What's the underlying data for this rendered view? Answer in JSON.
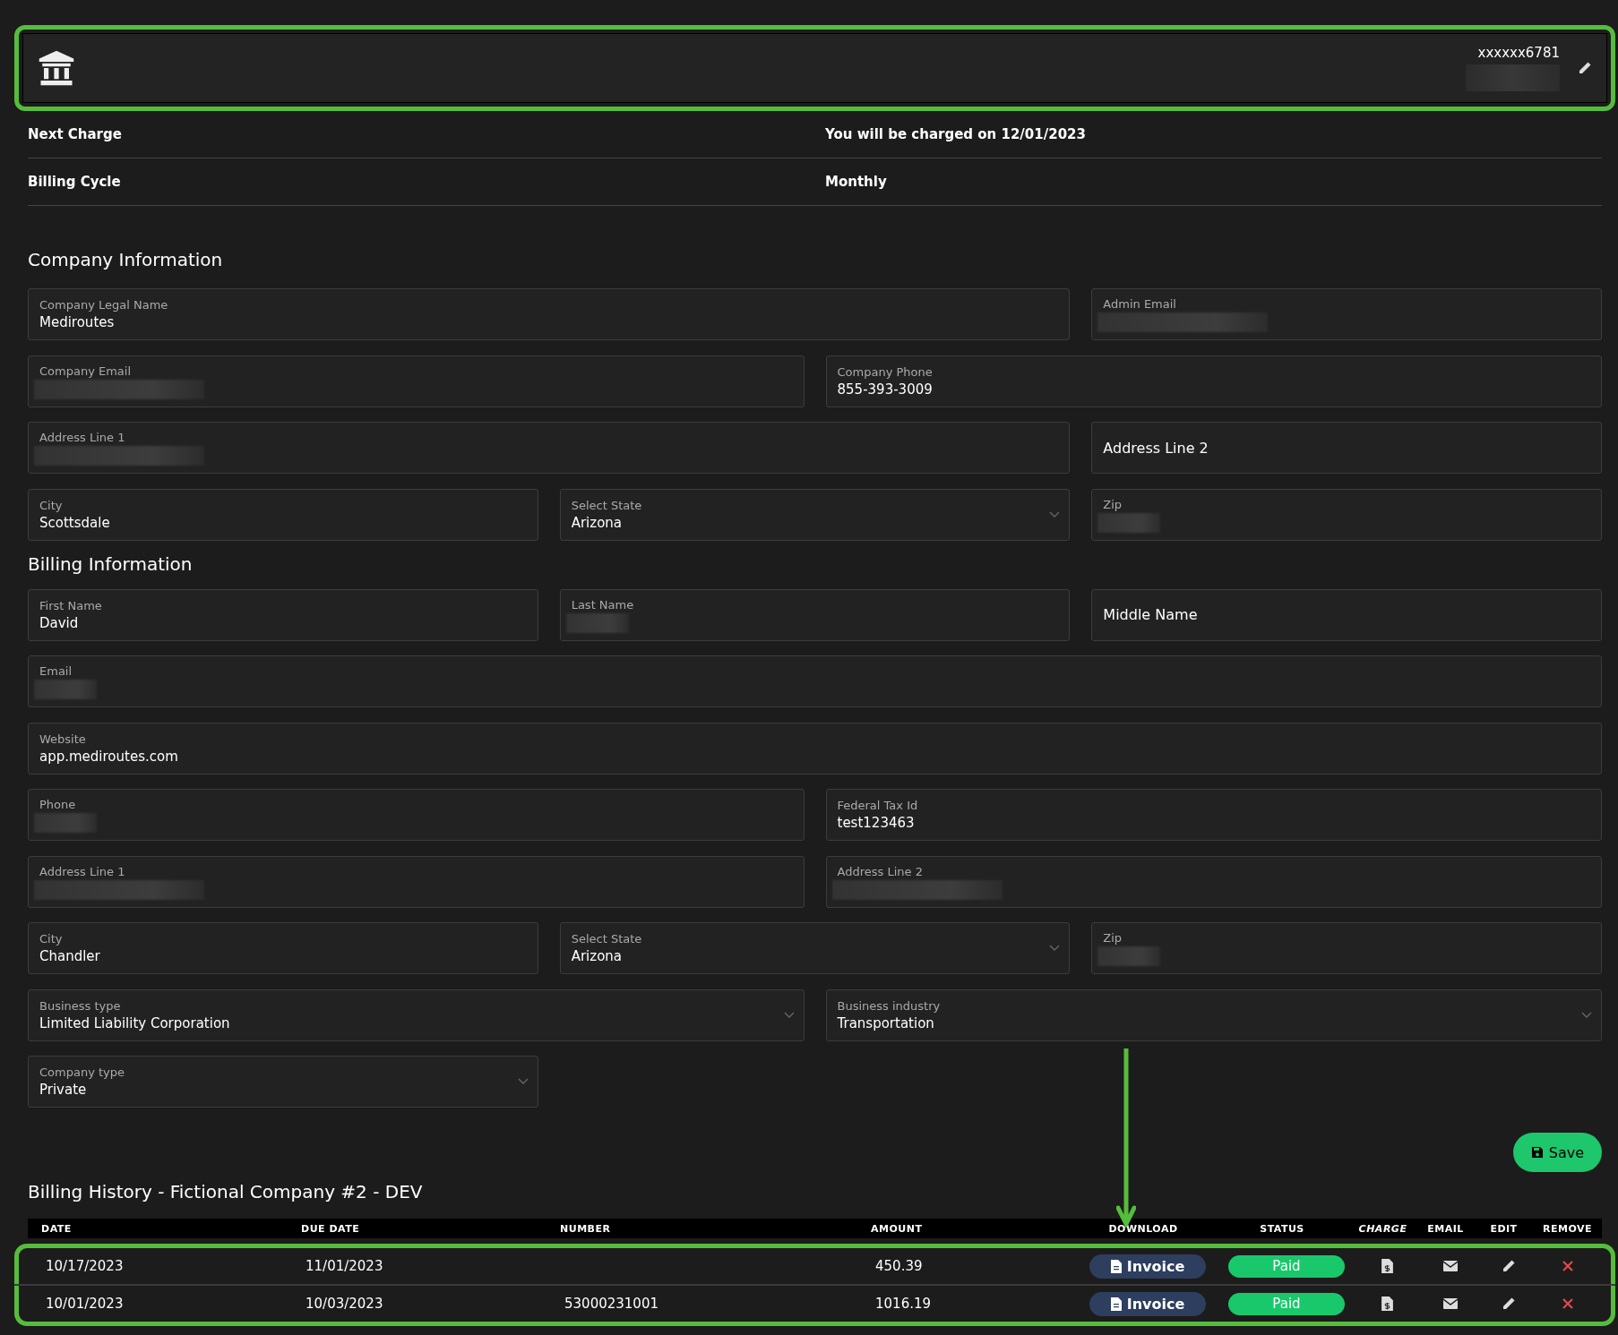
{
  "account": {
    "masked_number": "xxxxxx6781",
    "number_redacted": true
  },
  "summary": [
    {
      "label": "Next Charge",
      "value": "You will be charged on 12/01/2023"
    },
    {
      "label": "Billing Cycle",
      "value": "Monthly"
    }
  ],
  "sections": [
    {
      "title": "Company Information",
      "rows": [
        [
          {
            "kind": "text",
            "label": "Company Legal Name",
            "value": "Mediroutes"
          },
          {
            "kind": "text",
            "label": "Admin Email",
            "redacted": true
          }
        ],
        [
          {
            "kind": "text",
            "label": "Company Email",
            "redacted": true
          },
          {
            "kind": "text",
            "label": "Company Phone",
            "value": "855-393-3009"
          }
        ],
        [
          {
            "kind": "text",
            "label": "Address Line 1",
            "redacted": true
          },
          {
            "kind": "empty",
            "placeholder": "Address Line 2"
          }
        ],
        [
          {
            "kind": "text",
            "label": "City",
            "value": "Scottsdale"
          },
          {
            "kind": "select",
            "label": "Select State",
            "value": "Arizona"
          },
          {
            "kind": "text",
            "label": "Zip",
            "redacted": true
          }
        ]
      ]
    },
    {
      "title": "Billing Information",
      "rows": [
        [
          {
            "kind": "text",
            "label": "First Name",
            "value": "David"
          },
          {
            "kind": "text",
            "label": "Last Name",
            "redacted": true
          },
          {
            "kind": "empty",
            "placeholder": "Middle Name"
          }
        ],
        [
          {
            "kind": "text",
            "label": "Email",
            "redacted": true
          }
        ],
        [
          {
            "kind": "text",
            "label": "Website",
            "value": "app.mediroutes.com"
          }
        ],
        [
          {
            "kind": "text",
            "label": "Phone",
            "redacted": true
          },
          {
            "kind": "text",
            "label": "Federal Tax Id",
            "value": "test123463"
          }
        ],
        [
          {
            "kind": "text",
            "label": "Address Line 1",
            "redacted": true
          },
          {
            "kind": "text",
            "label": "Address Line 2",
            "redacted": true
          }
        ],
        [
          {
            "kind": "text",
            "label": "City",
            "value": "Chandler"
          },
          {
            "kind": "select",
            "label": "Select State",
            "value": "Arizona"
          },
          {
            "kind": "text",
            "label": "Zip",
            "redacted": true
          }
        ],
        [
          {
            "kind": "select",
            "label": "Business type",
            "value": "Limited Liability Corporation"
          },
          {
            "kind": "select",
            "label": "Business industry",
            "value": "Transportation"
          }
        ],
        [
          {
            "kind": "select",
            "label": "Company type",
            "value": "Private"
          }
        ]
      ]
    }
  ],
  "save_button": "Save",
  "history": {
    "title": "Billing History - Fictional Company #2 - DEV",
    "columns": [
      "DATE",
      "DUE DATE",
      "NUMBER",
      "AMOUNT",
      "DOWNLOAD",
      "STATUS",
      "CHARGE",
      "EMAIL",
      "EDIT",
      "REMOVE"
    ],
    "rows": [
      {
        "date": "10/17/2023",
        "due_date": "11/01/2023",
        "number": "",
        "amount": "450.39",
        "download": "Invoice",
        "status": "Paid"
      },
      {
        "date": "10/01/2023",
        "due_date": "10/03/2023",
        "number": "53000231001",
        "amount": "1016.19",
        "download": "Invoice",
        "status": "Paid"
      }
    ]
  }
}
